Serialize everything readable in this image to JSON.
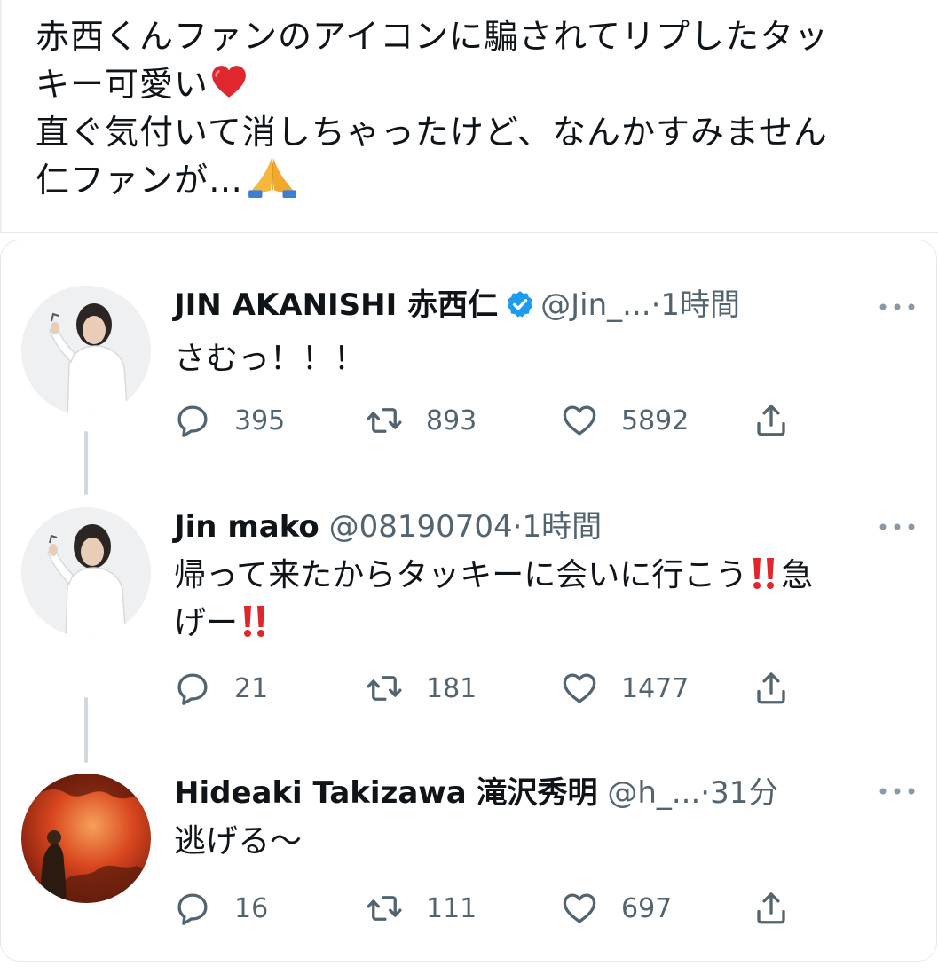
{
  "post": {
    "lines": [
      "赤西くんファンのアイコンに騙されてリプしたタッ",
      "キー可愛い",
      "直ぐ気付いて消しちゃったけど、なんかすみません",
      "仁ファンが…"
    ],
    "line2_emoji": "heart-emoji",
    "line4_emoji": "folded-hands-emoji"
  },
  "tweets": [
    {
      "display_name": "JIN AKANISHI 赤西仁",
      "verified": true,
      "handle": "@Jin_...",
      "dot": "·",
      "time": "1時間",
      "text": "さむっ！！！",
      "replies": "395",
      "retweets": "893",
      "likes": "5892"
    },
    {
      "display_name": "Jin mako",
      "verified": false,
      "handle": "@08190704",
      "dot": "·",
      "time": "1時間",
      "text_line1_a": "帰って来たからタッキーに会いに行こう",
      "text_line1_b": "急",
      "text_line2": "げー",
      "replies": "21",
      "retweets": "181",
      "likes": "1477"
    },
    {
      "display_name": "Hideaki Takizawa 滝沢秀明",
      "verified": false,
      "handle": "@h_...",
      "dot": "·",
      "time": "31分",
      "text": "逃げる〜",
      "replies": "16",
      "retweets": "111",
      "likes": "697"
    }
  ],
  "colors": {
    "text": "#0f1419",
    "secondary": "#536471",
    "verified": "#1d9bf0",
    "thread_line": "#cfd9de",
    "bangbang": "#e0262b"
  }
}
